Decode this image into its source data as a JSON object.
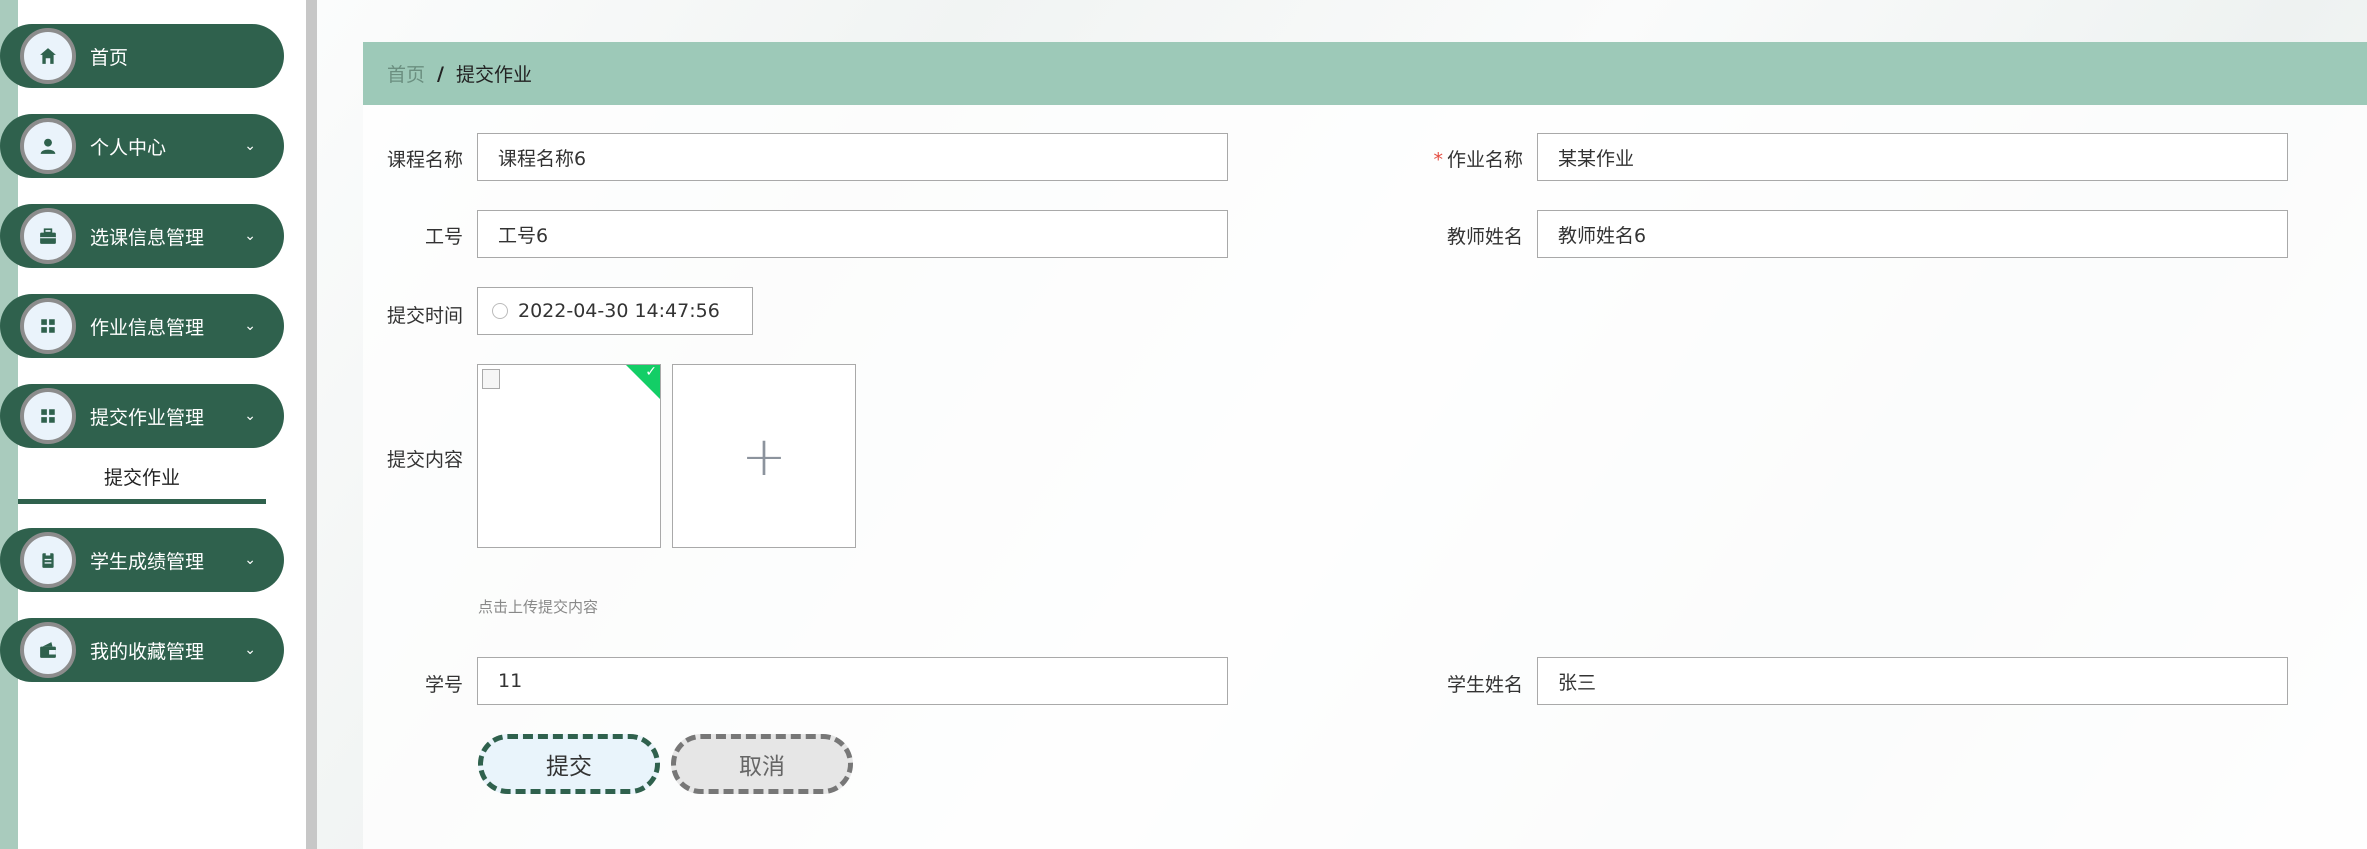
{
  "sidebar": {
    "items": [
      {
        "label": "首页",
        "icon": "home-icon",
        "has_children": false
      },
      {
        "label": "个人中心",
        "icon": "user-icon",
        "has_children": true
      },
      {
        "label": "选课信息管理",
        "icon": "briefcase-icon",
        "has_children": true
      },
      {
        "label": "作业信息管理",
        "icon": "grid-icon",
        "has_children": true
      },
      {
        "label": "提交作业管理",
        "icon": "grid-icon",
        "has_children": true
      },
      {
        "label": "学生成绩管理",
        "icon": "clipboard-icon",
        "has_children": true
      },
      {
        "label": "我的收藏管理",
        "icon": "wallet-icon",
        "has_children": true
      }
    ],
    "active_submenu": "提交作业",
    "accent_color": "#2f614d"
  },
  "breadcrumb": {
    "home": "首页",
    "separator": "/",
    "current": "提交作业"
  },
  "form": {
    "course_name": {
      "label": "课程名称",
      "value": "课程名称6"
    },
    "homework_name": {
      "label": "作业名称",
      "value": "某某作业",
      "required": true
    },
    "employee_id": {
      "label": "工号",
      "value": "工号6"
    },
    "teacher_name": {
      "label": "教师姓名",
      "value": "教师姓名6"
    },
    "submit_time": {
      "label": "提交时间",
      "value": "2022-04-30 14:47:56"
    },
    "submit_content": {
      "label": "提交内容",
      "hint": "点击上传提交内容"
    },
    "student_id": {
      "label": "学号",
      "value": "11"
    },
    "student_name": {
      "label": "学生姓名",
      "value": "张三"
    }
  },
  "buttons": {
    "submit": "提交",
    "cancel": "取消"
  }
}
